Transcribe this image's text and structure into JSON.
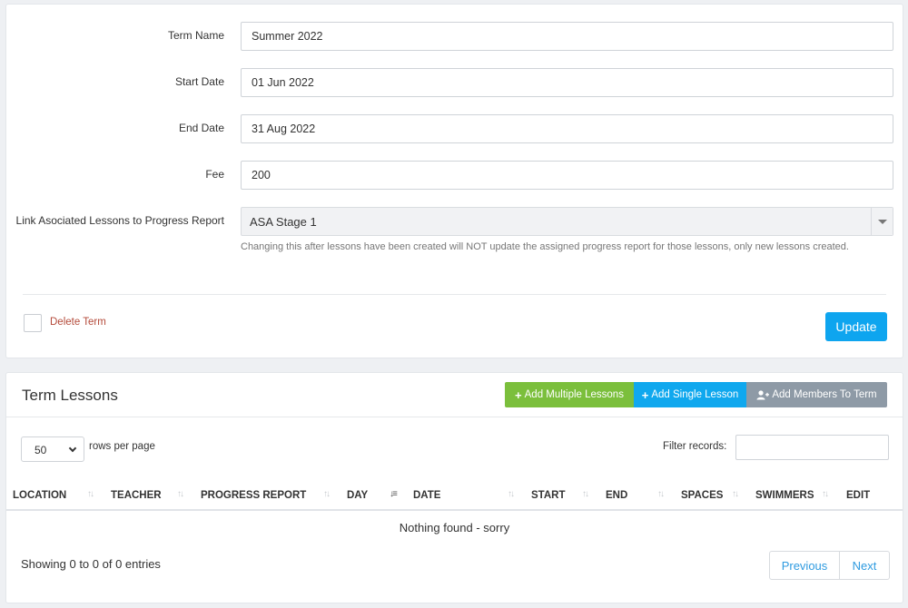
{
  "form": {
    "term_name": {
      "label": "Term Name",
      "value": "Summer 2022"
    },
    "start_date": {
      "label": "Start Date",
      "value": "01 Jun 2022"
    },
    "end_date": {
      "label": "End Date",
      "value": "31 Aug 2022"
    },
    "fee": {
      "label": "Fee",
      "value": "200"
    },
    "progress_report": {
      "label": "Link Asociated Lessons to Progress Report",
      "selected": "ASA Stage 1",
      "help": "Changing this after lessons have been created will NOT update the assigned progress report for those lessons, only new lessons created."
    },
    "delete_label": "Delete Term",
    "update_label": "Update"
  },
  "lessons": {
    "title": "Term Lessons",
    "buttons": {
      "add_multiple": "Add Multiple Lessons",
      "add_single": "Add Single Lesson",
      "add_members": "Add Members To Term"
    },
    "rows_per_page_value": "50",
    "rows_per_page_label": "rows per page",
    "filter_label": "Filter records:",
    "columns": [
      "LOCATION",
      "TEACHER",
      "PROGRESS REPORT",
      "DAY",
      "DATE",
      "START",
      "END",
      "SPACES",
      "SWIMMERS",
      "EDIT"
    ],
    "empty_message": "Nothing found - sorry",
    "showing": "Showing 0 to 0 of 0 entries",
    "pager": {
      "previous": "Previous",
      "next": "Next"
    }
  },
  "icons": {
    "add": "plus-icon",
    "members": "user-plus-icon",
    "sort": "sort-icon"
  },
  "colors": {
    "update": "#0ea5ef",
    "add_multiple": "#7bbf3c",
    "add_single": "#10a8ee",
    "add_members": "#8e9aa6",
    "delete_text": "#b44a3a"
  }
}
